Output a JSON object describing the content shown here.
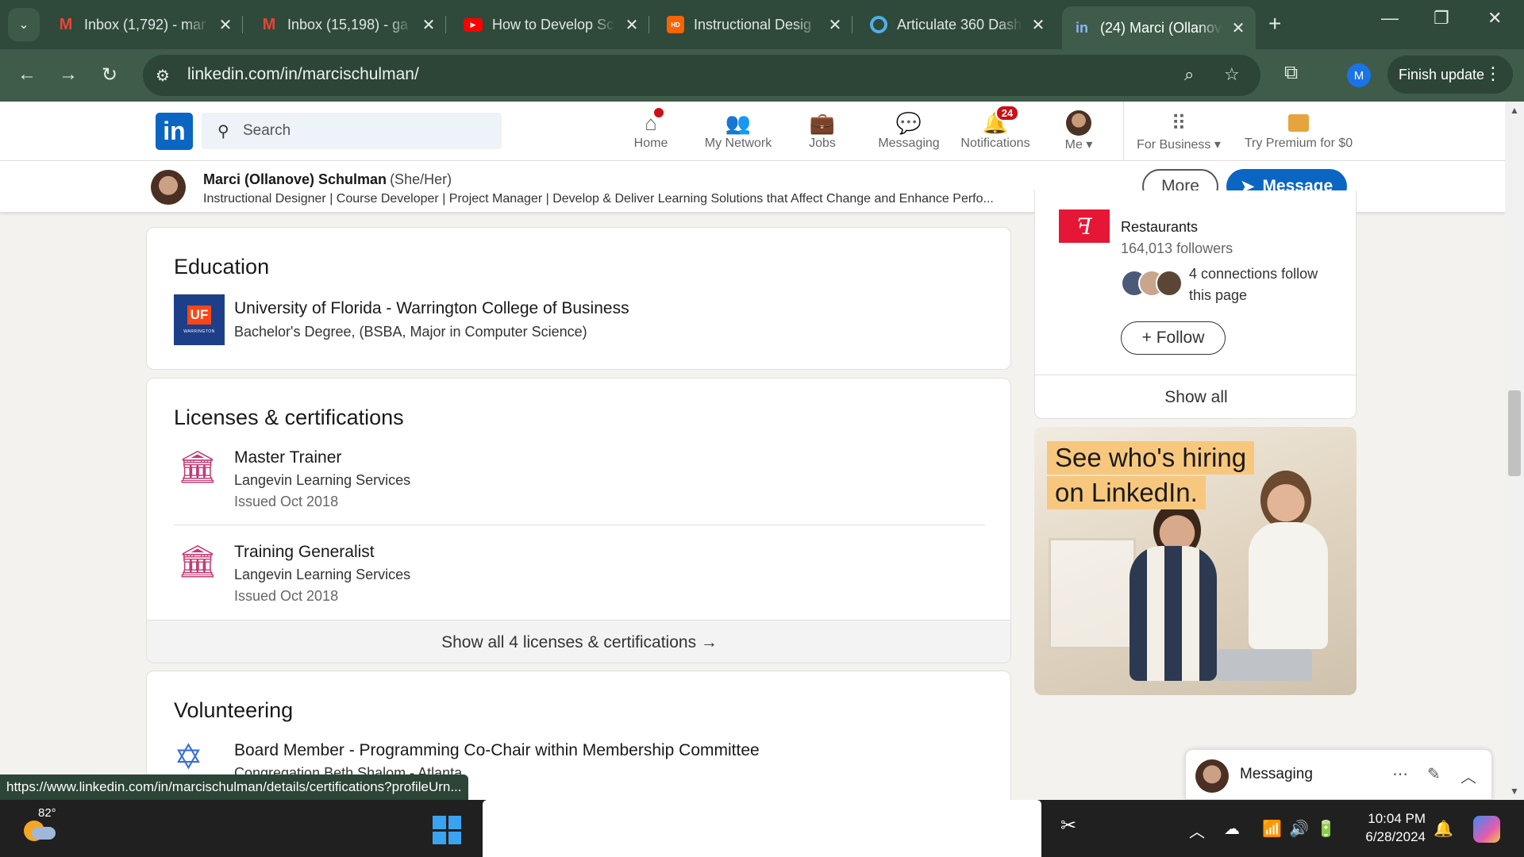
{
  "browser": {
    "tabs": [
      {
        "title": "Inbox (1,792) - mar",
        "favicon": "gmail-icon"
      },
      {
        "title": "Inbox (15,198) - ga",
        "favicon": "gmail-icon"
      },
      {
        "title": "How to Develop Sc",
        "favicon": "youtube-icon"
      },
      {
        "title": "Instructional Desig",
        "favicon": "home-depot-icon"
      },
      {
        "title": "Articulate 360 Dash",
        "favicon": "articulate-icon"
      },
      {
        "title": "(24) Marci (Ollanove",
        "favicon": "linkedin-icon"
      }
    ],
    "url": "linkedin.com/in/marcischulman/",
    "profile_initial": "M",
    "finish_update_label": "Finish update",
    "status_url": "https://www.linkedin.com/in/marcischulman/details/certifications?profileUrn..."
  },
  "linkedin_nav": {
    "search_placeholder": "Search",
    "items": [
      {
        "label": "Home"
      },
      {
        "label": "My Network"
      },
      {
        "label": "Jobs"
      },
      {
        "label": "Messaging"
      },
      {
        "label": "Notifications",
        "badge": "24"
      },
      {
        "label": "Me"
      },
      {
        "label": "For Business"
      },
      {
        "label": "Try Premium for $0"
      }
    ]
  },
  "profile_header": {
    "name": "Marci (Ollanove) Schulman",
    "pronouns": "(She/Her)",
    "headline": "Instructional Designer | Course Developer | Project Manager | Develop & Deliver Learning Solutions that Affect Change and Enhance Perfo...",
    "more_label": "More",
    "message_label": "Message"
  },
  "education": {
    "heading": "Education",
    "school": "University of Florida - Warrington College of Business",
    "degree": "Bachelor's Degree, (BSBA, Major in Computer Science)",
    "logo_text": "UF",
    "logo_subtext": "WARRINGTON"
  },
  "licenses": {
    "heading": "Licenses & certifications",
    "items": [
      {
        "title": "Master Trainer",
        "issuer": "Langevin Learning Services",
        "issued": "Issued Oct 2018"
      },
      {
        "title": "Training Generalist",
        "issuer": "Langevin Learning Services",
        "issued": "Issued Oct 2018"
      }
    ],
    "show_all": "Show all 4 licenses & certifications →"
  },
  "volunteering": {
    "heading": "Volunteering",
    "title": "Board Member - Programming Co-Chair within Membership Committee",
    "org": "Congregation Beth Shalom - Atlanta"
  },
  "right_rail": {
    "company_type": "Restaurants",
    "followers": "164,013 followers",
    "connections_line1": "4 connections follow",
    "connections_line2": "this page",
    "follow_label": "+ Follow",
    "show_all": "Show all"
  },
  "ad": {
    "line1": "See who's hiring",
    "line2": "on LinkedIn."
  },
  "messaging": {
    "label": "Messaging"
  },
  "taskbar": {
    "temperature": "82°",
    "time": "10:04 PM",
    "date": "6/28/2024"
  },
  "colors": {
    "linkedin_blue": "#0a66c2",
    "chrome_frame": "#2f4a3b",
    "notification_red": "#cc1016",
    "cert_icon": "#c43b74"
  }
}
